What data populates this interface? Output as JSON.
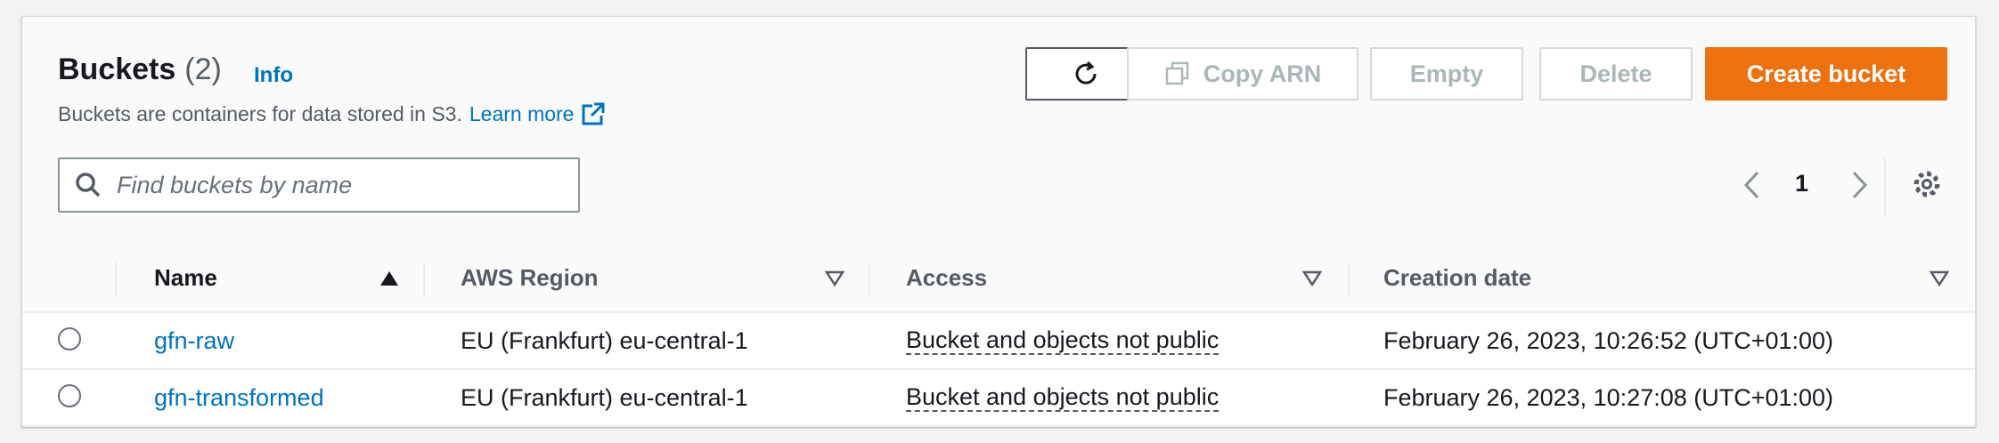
{
  "header": {
    "title": "Buckets",
    "count": "(2)",
    "info": "Info",
    "description": "Buckets are containers for data stored in S3.",
    "learn_more": "Learn more"
  },
  "actions": {
    "copy_arn": "Copy ARN",
    "empty": "Empty",
    "delete": "Delete",
    "create_bucket": "Create bucket"
  },
  "search": {
    "placeholder": "Find buckets by name"
  },
  "pagination": {
    "current_page": "1"
  },
  "table": {
    "columns": [
      "Name",
      "AWS Region",
      "Access",
      "Creation date"
    ],
    "rows": [
      {
        "name": "gfn-raw",
        "region": "EU (Frankfurt) eu-central-1",
        "access": "Bucket and objects not public",
        "created": "February 26, 2023, 10:26:52 (UTC+01:00)"
      },
      {
        "name": "gfn-transformed",
        "region": "EU (Frankfurt) eu-central-1",
        "access": "Bucket and objects not public",
        "created": "February 26, 2023, 10:27:08 (UTC+01:00)"
      }
    ]
  },
  "colors": {
    "primary": "#ec7211",
    "link": "#0073bb",
    "disabled_text": "#aab7b8"
  },
  "icons": [
    "refresh-icon",
    "copy-icon",
    "external-link-icon",
    "search-icon",
    "chevron-left-icon",
    "chevron-right-icon",
    "gear-icon",
    "sort-ascending-icon",
    "sort-icon"
  ]
}
